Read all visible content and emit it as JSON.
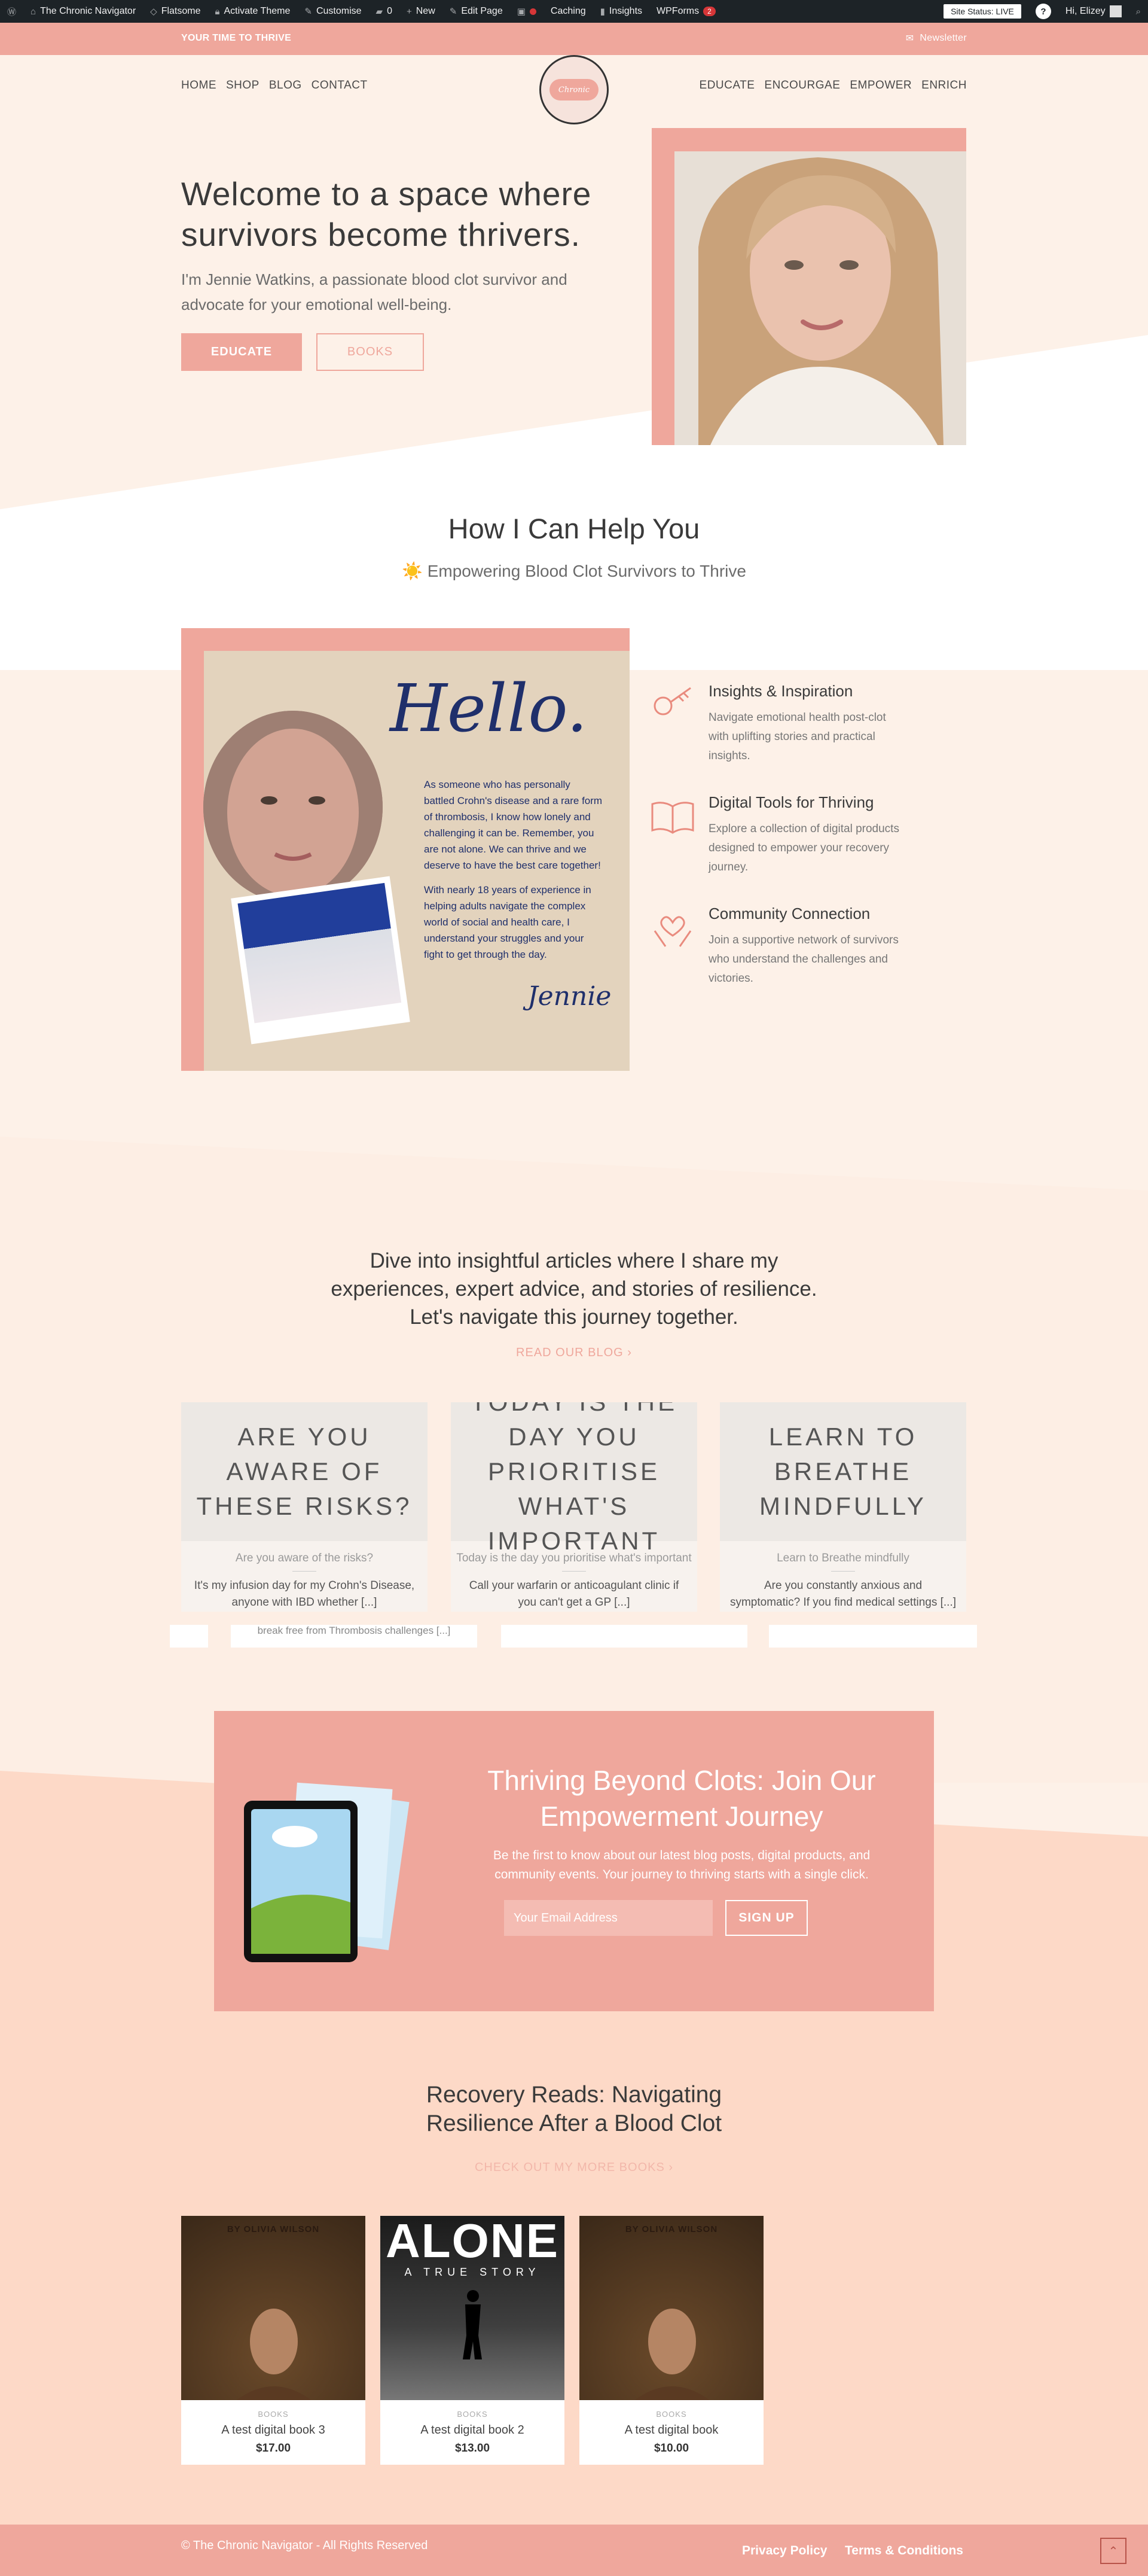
{
  "admin_bar": {
    "site_name": "The Chronic Navigator",
    "items": [
      "Flatsome",
      "Activate Theme",
      "Customise",
      "0",
      "New",
      "Edit Page",
      "Caching",
      "Insights",
      "WPForms"
    ],
    "wpforms_count": "2",
    "site_status": "Site Status: LIVE",
    "greeting": "Hi, Elizey"
  },
  "topbar": {
    "tagline": "YOUR TIME TO THRIVE",
    "newsletter": "Newsletter"
  },
  "nav": {
    "left": [
      "HOME",
      "SHOP",
      "BLOG",
      "CONTACT"
    ],
    "right": [
      "EDUCATE",
      "ENCOURGAE",
      "EMPOWER",
      "ENRICH"
    ],
    "logo_text": "Chronic"
  },
  "hero": {
    "title": "Welcome to a space where survivors become thrivers.",
    "subtitle": "I'm Jennie Watkins, a passionate blood clot survivor and advocate for your emotional well-being.",
    "btn_educate": "EDUCATE",
    "btn_books": "BOOKS"
  },
  "help": {
    "title": "How I Can Help You",
    "subtitle": "☀️ Empowering Blood Clot Survivors to Thrive",
    "hello_word": "Hello.",
    "hello_p1": "As someone who has personally battled Crohn's disease and a rare form of thrombosis, I know how lonely and challenging it can be. Remember, you are not alone. We can thrive and we deserve to have the best care together!",
    "hello_p2": "With nearly 18 years of experience in helping adults navigate the complex world of social and health care, I understand your struggles and your fight to get through the day.",
    "signature": "Jennie",
    "features": [
      {
        "title": "Insights & Inspiration",
        "desc": "Navigate emotional health post-clot with uplifting stories and practical insights.",
        "icon": "key-icon"
      },
      {
        "title": "Digital Tools for Thriving",
        "desc": "Explore a collection of digital products designed to empower your recovery journey.",
        "icon": "book-icon"
      },
      {
        "title": "Community Connection",
        "desc": "Join a supportive network of survivors who understand the challenges and victories.",
        "icon": "hands-heart-icon"
      }
    ]
  },
  "blog": {
    "intro": "Dive into insightful articles where I share my experiences, expert advice, and stories of resilience. Let's navigate this journey together.",
    "link": "READ OUR BLOG",
    "posts": [
      {
        "image_text": "ARE YOU AWARE OF THESE RISKS?",
        "title": "Are you aware of the risks?",
        "excerpt": "It's my infusion day for my Crohn's Disease, anyone with IBD whether [...]"
      },
      {
        "image_text": "TODAY IS THE DAY YOU PRIORITISE WHAT'S IMPORTANT",
        "title": "Today is the day you prioritise what's important",
        "excerpt": "Call your warfarin or anticoagulant clinic if you can't get a GP [...]"
      },
      {
        "image_text": "LEARN TO BREATHE MINDFULLY",
        "title": "Learn to Breathe mindfully",
        "excerpt": "Are you constantly anxious and symptomatic? If you find medical settings [...]"
      }
    ],
    "ghost_text": "break free from Thrombosis challenges [...]"
  },
  "newsletter": {
    "title": "Thriving Beyond Clots: Join Our Empowerment Journey",
    "subtitle": "Be the first to know about our latest blog posts, digital products, and community events. Your journey to thriving starts with a single click.",
    "placeholder": "Your Email Address",
    "button": "SIGN UP"
  },
  "books": {
    "title": "Recovery Reads: Navigating Resilience After a Blood Clot",
    "link": "CHECK OUT MY MORE BOOKS",
    "items": [
      {
        "category": "BOOKS",
        "name": "A test digital book 3",
        "price": "$17.00",
        "cover_author": "BY OLIVIA WILSON"
      },
      {
        "category": "BOOKS",
        "name": "A test digital book 2",
        "price": "$13.00",
        "cover_title": "ALONE",
        "cover_sub": "A TRUE STORY"
      },
      {
        "category": "BOOKS",
        "name": "A test digital book",
        "price": "$10.00",
        "cover_author": "BY OLIVIA WILSON"
      }
    ]
  },
  "footer": {
    "copyright": "© The Chronic Navigator - All Rights Reserved",
    "links": [
      "Privacy Policy",
      "Terms & Conditions"
    ]
  },
  "colors": {
    "brand_pink": "#efa79c",
    "cream": "#fdf1e8",
    "navy_script": "#1f2f6b"
  }
}
